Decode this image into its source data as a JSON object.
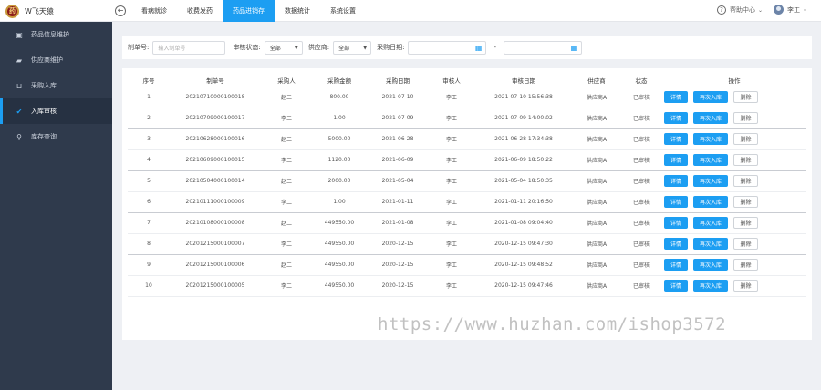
{
  "app": {
    "logo_text": "W飞天猿",
    "logo_mark": "药"
  },
  "nav": {
    "back_icon": "back-arrow-icon",
    "items": [
      {
        "label": "看病就诊"
      },
      {
        "label": "收费发药"
      },
      {
        "label": "药品进销存"
      },
      {
        "label": "数据统计"
      },
      {
        "label": "系统设置"
      }
    ],
    "active_index": 2
  },
  "header": {
    "help": "帮助中心",
    "user": "李工"
  },
  "sidebar": {
    "items": [
      {
        "label": "药品信息维护",
        "icon": "cabinet-icon"
      },
      {
        "label": "供应商维护",
        "icon": "truck-icon"
      },
      {
        "label": "采购入库",
        "icon": "cart-icon"
      },
      {
        "label": "入库审核",
        "icon": "check-icon"
      },
      {
        "label": "库存查询",
        "icon": "search-icon"
      }
    ],
    "active_index": 3
  },
  "filter": {
    "order_no_label": "制单号:",
    "order_no_placeholder": "输入制单号",
    "status_label": "审核状态:",
    "status_value": "全部",
    "supplier_label": "供应商:",
    "supplier_value": "全部",
    "date_label": "采购日期:",
    "date_sep": "-"
  },
  "table": {
    "columns": [
      "序号",
      "制单号",
      "采购人",
      "采购金额",
      "采购日期",
      "审核人",
      "审核日期",
      "供应商",
      "状态",
      "操作"
    ],
    "rows": [
      {
        "no": "1",
        "order": "20210710000100018",
        "buyer": "赵二",
        "amount": "800.00",
        "date": "2021-07-10",
        "auditor": "李工",
        "audit_date": "2021-07-10 15:56:38",
        "supplier": "供应商A",
        "status": "已审核",
        "actions": [
          "详情",
          "再次入库",
          "删除"
        ]
      },
      {
        "no": "2",
        "order": "20210709000100017",
        "buyer": "李二",
        "amount": "1.00",
        "date": "2021-07-09",
        "auditor": "李工",
        "audit_date": "2021-07-09 14:00:02",
        "supplier": "供应商A",
        "status": "已审核",
        "actions": [
          "详情",
          "再次入库",
          "删除"
        ]
      },
      {
        "no": "3",
        "order": "20210628000100016",
        "buyer": "赵二",
        "amount": "5000.00",
        "date": "2021-06-28",
        "auditor": "李工",
        "audit_date": "2021-06-28 17:34:38",
        "supplier": "供应商A",
        "status": "已审核",
        "actions": [
          "详情",
          "再次入库",
          "删除"
        ]
      },
      {
        "no": "4",
        "order": "20210609000100015",
        "buyer": "李二",
        "amount": "1120.00",
        "date": "2021-06-09",
        "auditor": "李工",
        "audit_date": "2021-06-09 18:50:22",
        "supplier": "供应商A",
        "status": "已审核",
        "actions": [
          "详情",
          "再次入库",
          "删除"
        ]
      },
      {
        "no": "5",
        "order": "20210504000100014",
        "buyer": "赵二",
        "amount": "2000.00",
        "date": "2021-05-04",
        "auditor": "李工",
        "audit_date": "2021-05-04 18:50:35",
        "supplier": "供应商A",
        "status": "已审核",
        "actions": [
          "详情",
          "再次入库",
          "删除"
        ]
      },
      {
        "no": "6",
        "order": "20210111000100009",
        "buyer": "李二",
        "amount": "1.00",
        "date": "2021-01-11",
        "auditor": "李工",
        "audit_date": "2021-01-11 20:16:50",
        "supplier": "供应商A",
        "status": "已审核",
        "actions": [
          "详情",
          "再次入库",
          "删除"
        ]
      },
      {
        "no": "7",
        "order": "20210108000100008",
        "buyer": "赵二",
        "amount": "449550.00",
        "date": "2021-01-08",
        "auditor": "李工",
        "audit_date": "2021-01-08 09:04:40",
        "supplier": "供应商A",
        "status": "已审核",
        "actions": [
          "详情",
          "再次入库",
          "删除"
        ]
      },
      {
        "no": "8",
        "order": "20201215000100007",
        "buyer": "李二",
        "amount": "449550.00",
        "date": "2020-12-15",
        "auditor": "李工",
        "audit_date": "2020-12-15 09:47:30",
        "supplier": "供应商A",
        "status": "已审核",
        "actions": [
          "详情",
          "再次入库",
          "删除"
        ]
      },
      {
        "no": "9",
        "order": "20201215000100006",
        "buyer": "赵二",
        "amount": "449550.00",
        "date": "2020-12-15",
        "auditor": "李工",
        "audit_date": "2020-12-15 09:48:52",
        "supplier": "供应商A",
        "status": "已审核",
        "actions": [
          "详情",
          "再次入库",
          "删除"
        ]
      },
      {
        "no": "10",
        "order": "20201215000100005",
        "buyer": "李二",
        "amount": "449550.00",
        "date": "2020-12-15",
        "auditor": "李工",
        "audit_date": "2020-12-15 09:47:46",
        "supplier": "供应商A",
        "status": "已审核",
        "actions": [
          "详情",
          "再次入库",
          "删除"
        ]
      }
    ]
  },
  "watermark": "https://www.huzhan.com/ishop3572",
  "colors": {
    "accent": "#1c9ef2",
    "sidebar": "#2f3a4c"
  }
}
